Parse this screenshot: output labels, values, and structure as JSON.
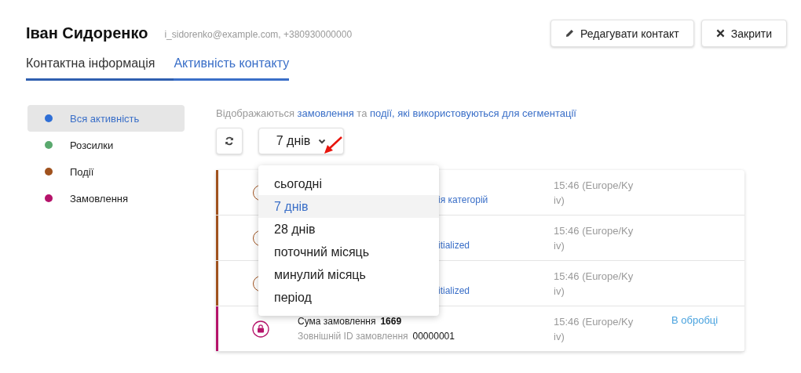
{
  "contact": {
    "name": "Іван Сидоренко",
    "details": "i_sidorenko@example.com, +380930000000"
  },
  "actions": [
    {
      "kind": "edit",
      "label": "Редагувати контакт"
    },
    {
      "kind": "close",
      "label": "Закрити"
    }
  ],
  "tabs": [
    {
      "label": "Контактна інформація",
      "selected": false
    },
    {
      "label": "Активність контакту",
      "selected": true
    }
  ],
  "filters": [
    {
      "label": "Вся активність",
      "color": "#2f6fd6",
      "selected": true
    },
    {
      "label": "Розсилки",
      "color": "#5aa96e",
      "selected": false
    },
    {
      "label": "Події",
      "color": "#a0521e",
      "selected": false
    },
    {
      "label": "Замовлення",
      "color": "#b5136a",
      "selected": false
    }
  ],
  "info": [
    {
      "text": "Відображаються ",
      "link": false
    },
    {
      "text": "замовлення",
      "link": true
    },
    {
      "text": " та ",
      "link": false
    },
    {
      "text": "події, які використовуються для сегментації",
      "link": true
    }
  ],
  "period": {
    "value": "7 днів",
    "open": true,
    "options": [
      {
        "label": "сьогодні",
        "selected": false
      },
      {
        "label": "7 днів",
        "selected": true
      },
      {
        "label": "28 днів",
        "selected": false
      },
      {
        "label": "поточний місяць",
        "selected": false
      },
      {
        "label": "минулий місяць",
        "selected": false
      },
      {
        "label": "період",
        "selected": false
      }
    ]
  },
  "rows": [
    {
      "kind": "event",
      "color": "#a0521e",
      "link": "ія категорій",
      "time": "15:46 (Europe/Kyiv)"
    },
    {
      "kind": "event",
      "color": "#a0521e",
      "link": "itialized",
      "time": "15:46 (Europe/Kyiv)"
    },
    {
      "kind": "event",
      "color": "#a0521e",
      "link": "itialized",
      "time": "15:46 (Europe/Kyiv)"
    },
    {
      "kind": "order",
      "color": "#b5136a",
      "sum_label": "Сума замовлення",
      "sum": "1669",
      "id_label": "Зовнішній ID замовлення",
      "id": "00000001",
      "time": "15:46 (Europe/Kyiv)",
      "status": "В обробці"
    }
  ]
}
